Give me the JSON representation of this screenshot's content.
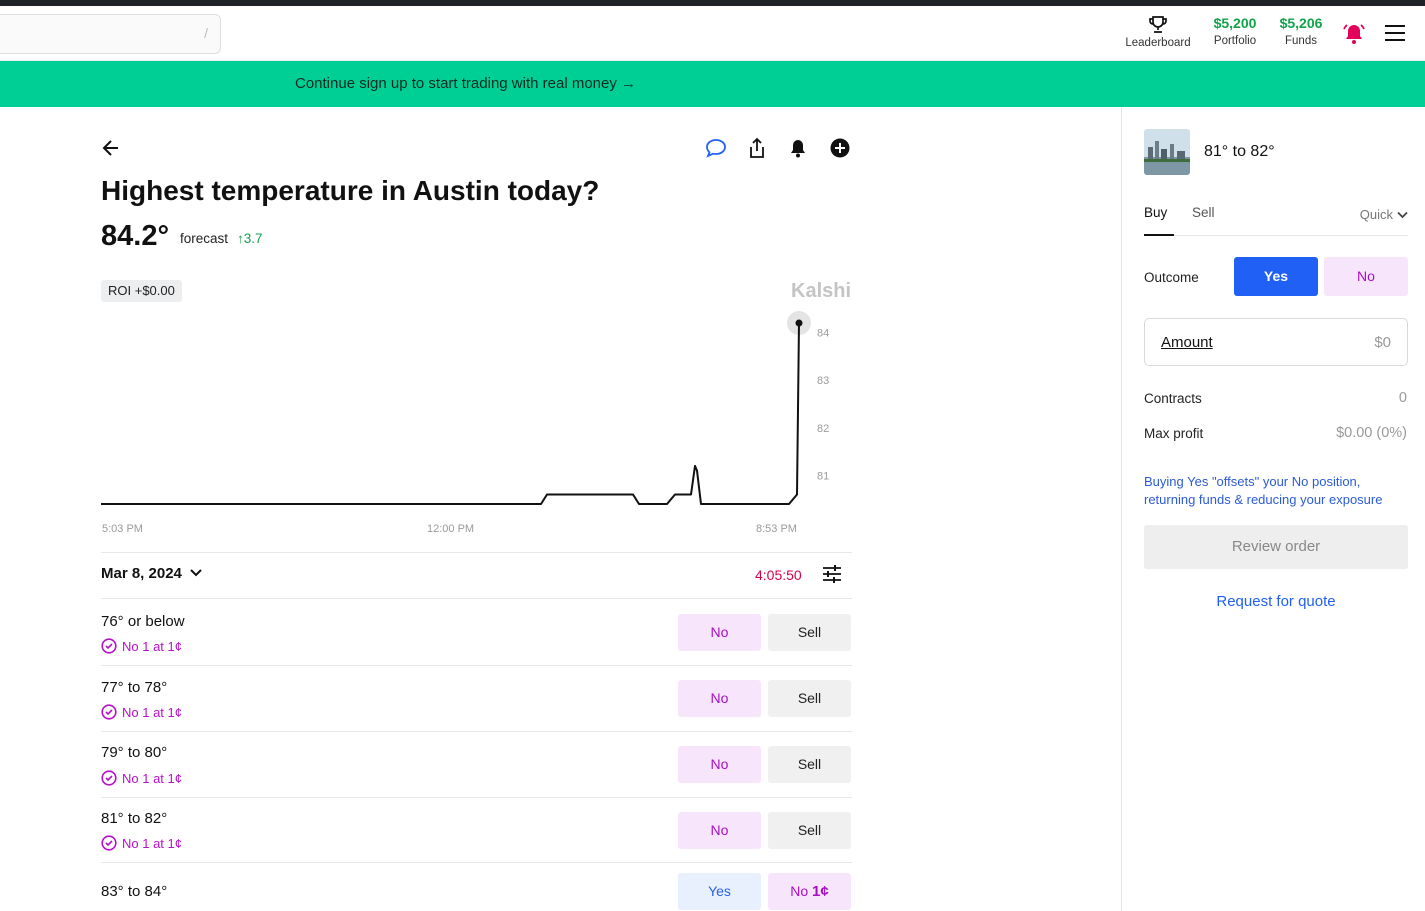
{
  "header": {
    "search_slash": "/",
    "leaderboard_label": "Leaderboard",
    "portfolio_value": "$5,200",
    "portfolio_label": "Portfolio",
    "funds_value": "$5,206",
    "funds_label": "Funds"
  },
  "banner": {
    "text": "Continue sign up to start trading with real money →"
  },
  "market": {
    "title": "Highest temperature in Austin today?",
    "forecast_value": "84.2°",
    "forecast_label": "forecast",
    "forecast_change": "↑3.7",
    "roi": "ROI +$0.00",
    "watermark": "Kalshi"
  },
  "chart_data": {
    "type": "line",
    "x_ticks": [
      "5:03 PM",
      "12:00 PM",
      "8:53 PM"
    ],
    "y_ticks": [
      84,
      83,
      82,
      81
    ],
    "ylim": [
      80.4,
      84.6
    ],
    "series": [
      {
        "x": [
          0,
          440,
          446,
          532,
          538,
          566,
          574,
          590,
          594,
          596,
          600,
          688,
          696,
          698
        ],
        "values": [
          80.4,
          80.4,
          80.6,
          80.6,
          80.4,
          80.4,
          80.6,
          80.6,
          81.2,
          81.1,
          80.4,
          80.4,
          80.6,
          84.2
        ]
      }
    ],
    "x_range": [
      0,
      698
    ],
    "line_color": "#111111"
  },
  "controls": {
    "date": "Mar 8, 2024",
    "countdown": "4:05:50"
  },
  "rows": [
    {
      "label": "76° or below",
      "position": "No 1 at 1¢",
      "btn1": "No",
      "btn2": "Sell"
    },
    {
      "label": "77° to 78°",
      "position": "No 1 at 1¢",
      "btn1": "No",
      "btn2": "Sell"
    },
    {
      "label": "79° to 80°",
      "position": "No 1 at 1¢",
      "btn1": "No",
      "btn2": "Sell"
    },
    {
      "label": "81° to 82°",
      "position": "No 1 at 1¢",
      "btn1": "No",
      "btn2": "Sell"
    },
    {
      "label": "83° to 84°",
      "btn_yes": "Yes",
      "btn_no_prefix": "No",
      "btn_no_price": "1¢"
    }
  ],
  "order": {
    "market_name": "81° to 82°",
    "tab_buy": "Buy",
    "tab_sell": "Sell",
    "mode": "Quick",
    "outcome_label": "Outcome",
    "outcome_yes": "Yes",
    "outcome_no": "No",
    "amount_label": "Amount",
    "amount_value": "$0",
    "contracts_label": "Contracts",
    "contracts_value": "0",
    "max_profit_label": "Max profit",
    "max_profit_value": "$0.00 (0%)",
    "note": "Buying Yes \"offsets\" your No position, returning funds & reducing your exposure",
    "review_button": "Review order",
    "rfq_link": "Request for quote"
  },
  "colors": {
    "banner": "#00cf95",
    "accent_blue": "#2160f5",
    "no_purple": "#a70fc2",
    "positive_green": "#11a34a",
    "countdown_red": "#d6004a"
  }
}
